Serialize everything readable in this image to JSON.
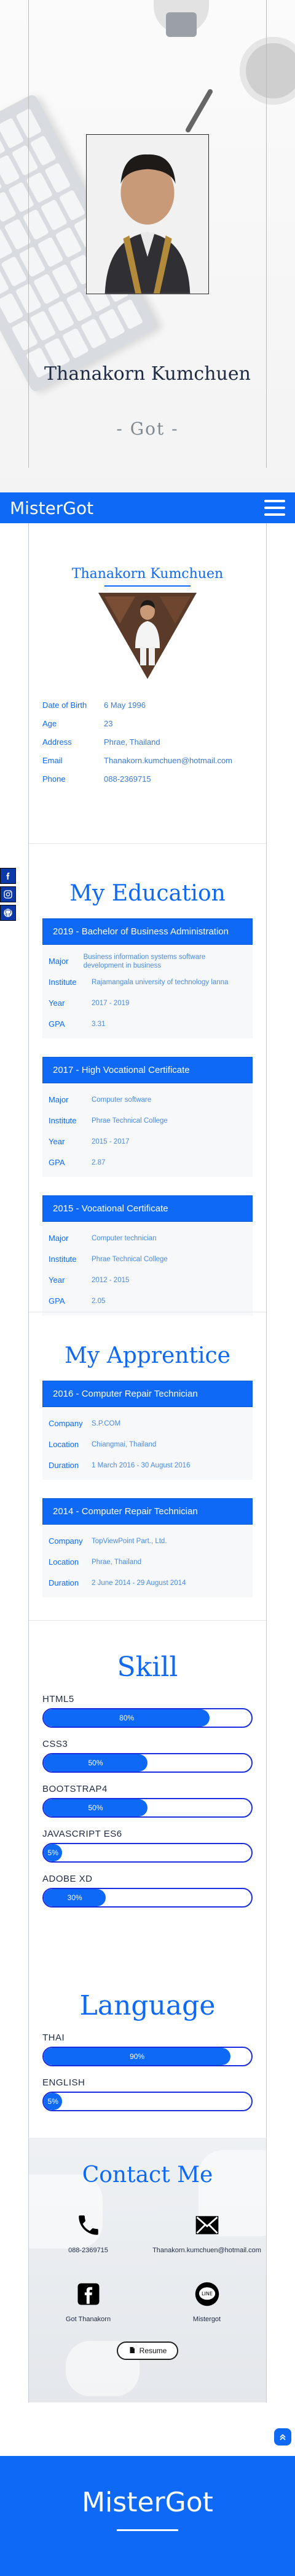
{
  "hero": {
    "name": "Thanakorn Kumchuen",
    "nickname": "- Got -"
  },
  "navbar": {
    "brand": "MisterGot"
  },
  "profile": {
    "title": "Thanakorn Kumchuen",
    "info": [
      {
        "label": "Date of Birth",
        "value": "6 May 1996"
      },
      {
        "label": "Age",
        "value": "23"
      },
      {
        "label": "Address",
        "value": "Phrae, Thailand"
      },
      {
        "label": "Email",
        "value": "Thanakorn.kumchuen@hotmail.com"
      },
      {
        "label": "Phone",
        "value": "088-2369715"
      }
    ]
  },
  "education": {
    "title": "My Education",
    "cards": [
      {
        "header": "2019 - Bachelor of Business Administration",
        "rows": [
          {
            "label": "Major",
            "value": "Business information systems software development in business"
          },
          {
            "label": "Institute",
            "value": "Rajamangala university of technology lanna"
          },
          {
            "label": "Year",
            "value": "2017 - 2019"
          },
          {
            "label": "GPA",
            "value": "3.31"
          }
        ]
      },
      {
        "header": "2017 - High Vocational Certificate",
        "rows": [
          {
            "label": "Major",
            "value": "Computer software"
          },
          {
            "label": "Institute",
            "value": "Phrae Technical College"
          },
          {
            "label": "Year",
            "value": "2015 - 2017"
          },
          {
            "label": "GPA",
            "value": "2.87"
          }
        ]
      },
      {
        "header": "2015 - Vocational Certificate",
        "rows": [
          {
            "label": "Major",
            "value": "Computer technician"
          },
          {
            "label": "Institute",
            "value": "Phrae Technical College"
          },
          {
            "label": "Year",
            "value": "2012 - 2015"
          },
          {
            "label": "GPA",
            "value": "2.05"
          }
        ]
      }
    ]
  },
  "apprentice": {
    "title": "My Apprentice",
    "cards": [
      {
        "header": "2016 - Computer Repair Technician",
        "rows": [
          {
            "label": "Company",
            "value": "S.P.COM"
          },
          {
            "label": "Location",
            "value": "Chiangmai, Thailand"
          },
          {
            "label": "Duration",
            "value": "1 March 2016 - 30 August 2016"
          }
        ]
      },
      {
        "header": "2014 - Computer Repair Technician",
        "rows": [
          {
            "label": "Company",
            "value": "TopViewPoint Part., Ltd."
          },
          {
            "label": "Location",
            "value": "Phrae, Thailand"
          },
          {
            "label": "Duration",
            "value": "2 June 2014 - 29 August 2014"
          }
        ]
      }
    ]
  },
  "skills": {
    "title": "Skill",
    "items": [
      {
        "name": "HTML5",
        "percent": 80,
        "label": "80%"
      },
      {
        "name": "CSS3",
        "percent": 50,
        "label": "50%"
      },
      {
        "name": "BOOTSTRAP4",
        "percent": 50,
        "label": "50%"
      },
      {
        "name": "JAVASCRIPT ES6",
        "percent": 5,
        "label": "5%"
      },
      {
        "name": "ADOBE XD",
        "percent": 30,
        "label": "30%"
      }
    ]
  },
  "language": {
    "title": "Language",
    "items": [
      {
        "name": "THAI",
        "percent": 90,
        "label": "90%"
      },
      {
        "name": "ENGLISH",
        "percent": 5,
        "label": "5%"
      }
    ]
  },
  "contact": {
    "title": "Contact Me",
    "phone": "088-2369715",
    "email": "Thanakorn.kumchuen@hotmail.com",
    "facebook": "Got Thanakorn",
    "line": "Mistergot",
    "resume_label": "Resume"
  },
  "footer": {
    "brand": "MisterGot"
  },
  "colors": {
    "primary": "#0e69f6",
    "bar_border": "#1a2ee0",
    "social_bg": "#0b3aa8"
  }
}
